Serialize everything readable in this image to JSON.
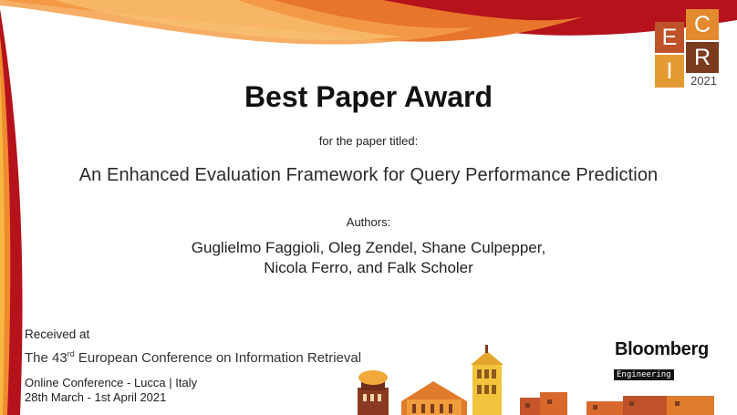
{
  "certificate": {
    "award_title": "Best Paper Award",
    "subtitle": "for the paper titled:",
    "paper_title": "An Enhanced Evaluation Framework for Query Performance Prediction",
    "authors_label": "Authors:",
    "authors_line1": "Guglielmo Faggioli, Oleg Zendel, Shane Culpepper,",
    "authors_line2": "Nicola Ferro, and Falk Scholer"
  },
  "footer": {
    "received_label": "Received at",
    "conference_prefix": "The 43",
    "conference_ordinal": "rd",
    "conference_name": " European Conference on Information Retrieval",
    "venue_line1": "Online Conference - Lucca | Italy",
    "venue_line2": "28th March - 1st April 2021"
  },
  "logo": {
    "letters": [
      "E",
      "C",
      "I",
      "R"
    ],
    "year": "2021"
  },
  "sponsor": {
    "name": "Bloomberg",
    "tag": "Engineering"
  },
  "colors": {
    "accent_red": "#b5121b",
    "accent_orange": "#e8702a",
    "accent_yellow": "#f5b335",
    "accent_brown": "#7a3b1e"
  }
}
